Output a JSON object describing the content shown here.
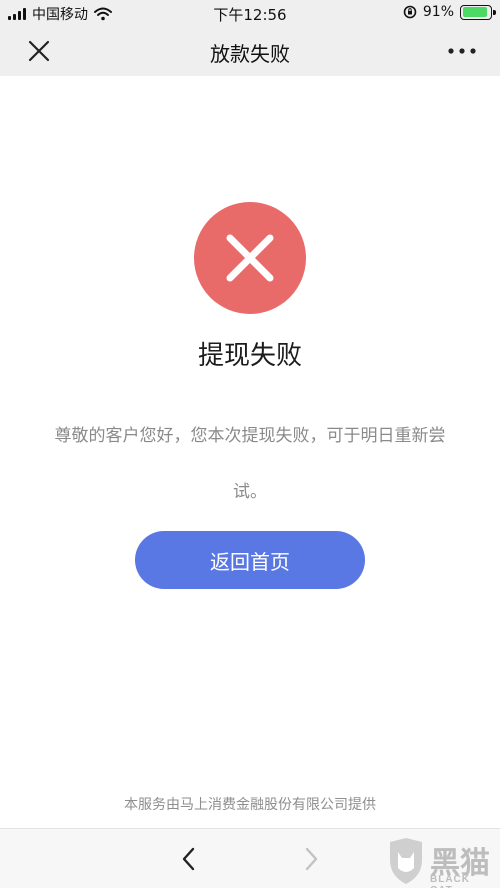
{
  "status_bar": {
    "carrier": "中国移动",
    "time": "下午12:56",
    "battery_percent": "91%",
    "battery_level": 0.91,
    "battery_color": "#4cd964"
  },
  "nav": {
    "title": "放款失败",
    "close_icon": "close-icon",
    "more_icon": "more-dots-icon"
  },
  "result": {
    "icon": "error-x-icon",
    "icon_color": "#e86b69",
    "title": "提现失败",
    "message": "尊敬的客户您好，您本次提现失败，可于明日重新尝试。"
  },
  "actions": {
    "home_label": "返回首页",
    "button_color": "#5a78e3"
  },
  "footer": {
    "provider_text": "本服务由马上消费金融股份有限公司提供"
  },
  "toolbar": {
    "back_icon": "chevron-left-icon",
    "forward_icon": "chevron-right-icon"
  },
  "watermark": {
    "cn": "黑猫",
    "en": "BLACK CAT"
  }
}
